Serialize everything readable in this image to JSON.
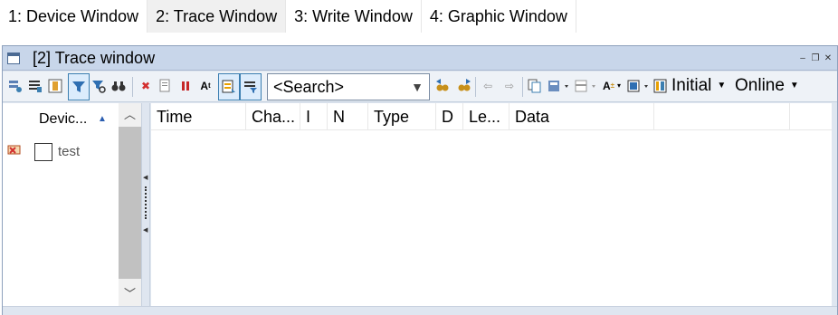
{
  "window_tabs": [
    {
      "label": "1: Device Window",
      "active": false
    },
    {
      "label": "2: Trace Window",
      "active": true
    },
    {
      "label": "3: Write Window",
      "active": false
    },
    {
      "label": "4: Graphic Window",
      "active": false
    }
  ],
  "trace_window": {
    "title": "[2] Trace window",
    "search_placeholder": "<Search>",
    "initial_label": "Initial",
    "online_label": "Online"
  },
  "device_panel": {
    "header": "Devic...",
    "devices": [
      {
        "name": "test",
        "checked": false
      }
    ]
  },
  "trace_grid": {
    "columns": [
      "Time",
      "Cha...",
      "I",
      "N",
      "Type",
      "D",
      "Le...",
      "Data"
    ]
  },
  "colors": {
    "titlebar": "#c8d6ea",
    "toolbar": "#eef2f7",
    "accent": "#3c7fb1",
    "error_red": "#d32f2f"
  }
}
